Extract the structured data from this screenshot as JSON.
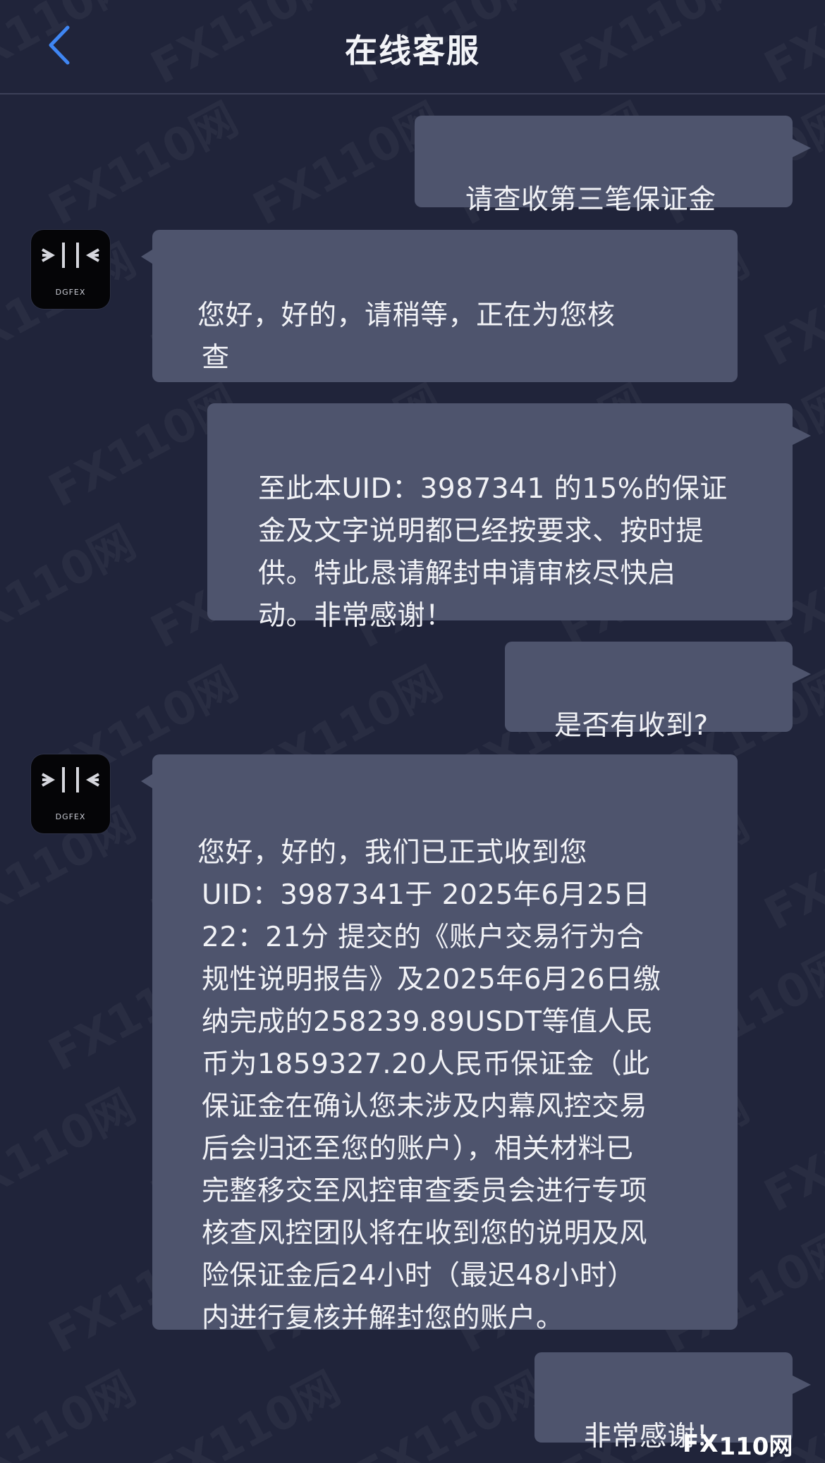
{
  "header": {
    "title": "在线客服",
    "back_icon": "chevron-left-icon",
    "back_color": "#3f86f3"
  },
  "agent": {
    "brand": "DGFEX"
  },
  "messages": [
    {
      "side": "out",
      "text": "请查收第三笔保证金"
    },
    {
      "side": "in",
      "text": " 您好，好的，请稍等，正在为您核\n查"
    },
    {
      "side": "out",
      "text": "至此本UID：3987341 的15%的保证\n金及文字说明都已经按要求、按时提\n供。特此恳请解封申请审核尽快启\n动。非常感谢！"
    },
    {
      "side": "out",
      "text": "是否有收到?"
    },
    {
      "side": "in",
      "text": " 您好，好的，我们已正式收到您\nUID：3987341于 2025年6月25日\n22：21分 提交的《账户交易行为合\n规性说明报告》及2025年6月26日缴\n纳完成的258239.89USDT等值人民\n币为1859327.20人民币保证金（此\n保证金在确认您未涉及内幕风控交易\n后会归还至您的账户），相关材料已\n完整移交至风控审查委员会进行专项\n核查风控团队将在收到您的说明及风\n险保证金后24小时（最迟48小时）\n内进行复核并解封您的账户。"
    },
    {
      "side": "out",
      "text": "非常感谢！"
    }
  ],
  "watermark": {
    "text": "110网",
    "prefix": "FX"
  },
  "footer_logo": {
    "prefix": "FX",
    "text": "110网"
  },
  "colors": {
    "background": "#20243a",
    "bubble": "#4e546d",
    "text": "#f1f2f6"
  }
}
